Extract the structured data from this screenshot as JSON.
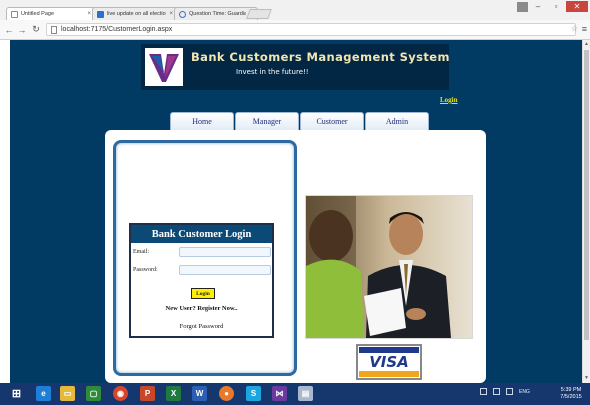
{
  "browser": {
    "tabs": [
      {
        "title": "Untitled Page",
        "active": true
      },
      {
        "title": "live update on all election",
        "active": false
      },
      {
        "title": "Question Time: Guardian",
        "active": false
      }
    ],
    "url": "localhost:7175/CustomerLogin.aspx"
  },
  "site": {
    "title": "Bank Customers Management System",
    "tagline": "Invest in the future!!",
    "top_login_link": "Login"
  },
  "menu": [
    "Home",
    "Manager",
    "Customer",
    "Admin"
  ],
  "login_form": {
    "heading": "Bank Customer Login",
    "email_label": "Email:",
    "password_label": "Password:",
    "email_value": "",
    "password_value": "",
    "login_button": "Login",
    "register_link": "New User? Register Now..",
    "forgot_link": "Forgot Password"
  },
  "card_logo": "VISA",
  "taskbar": {
    "lang": "ENG",
    "time": "5:39 PM",
    "date": "7/5/2015"
  },
  "colors": {
    "page_bg": "#013a63",
    "header_text": "#f3e5b0",
    "link_yellow": "#f0e000",
    "menu_text": "#1e2b7a"
  }
}
